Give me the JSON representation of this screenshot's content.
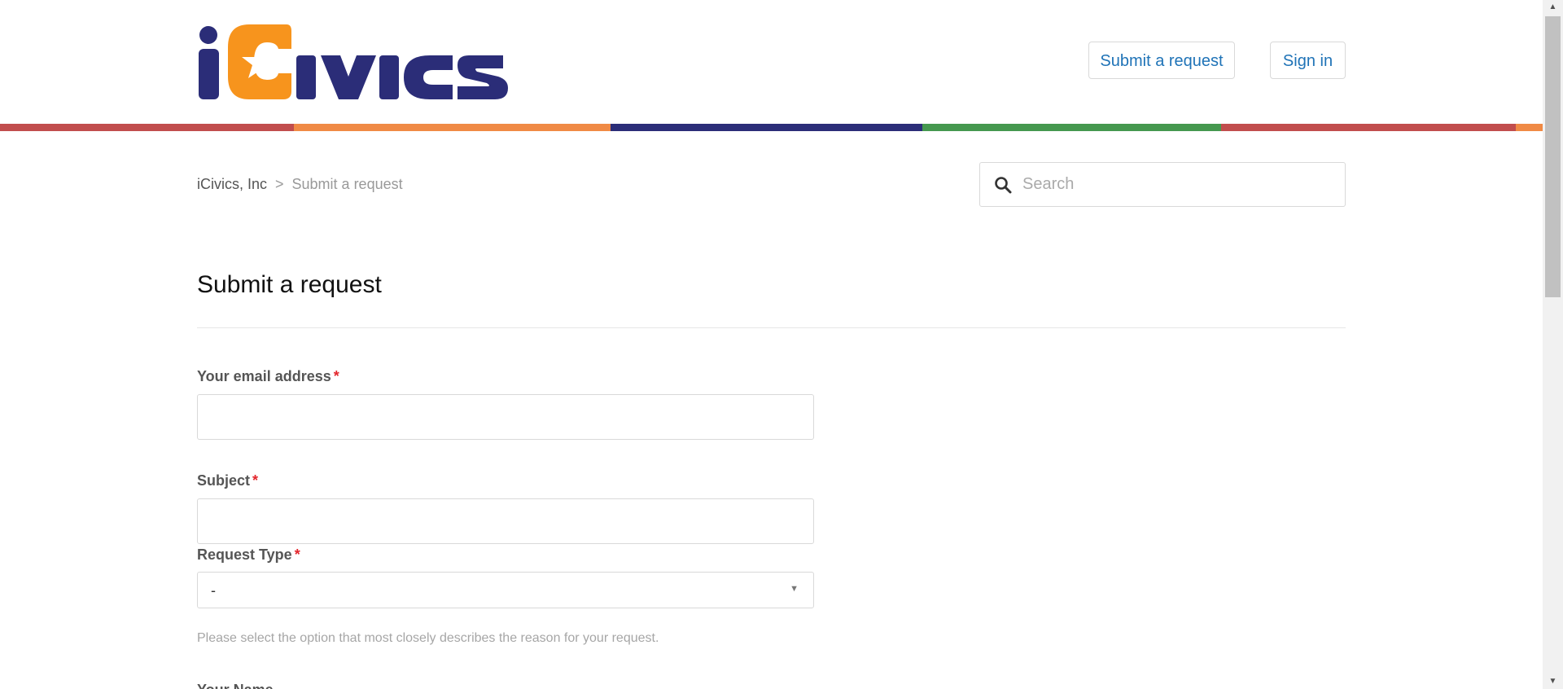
{
  "header": {
    "logo_text": "iCivics",
    "submit_request_label": "Submit a request",
    "sign_in_label": "Sign in"
  },
  "stripe_colors": [
    "#c14d4d",
    "#f08a45",
    "#2b2d78",
    "#45984f",
    "#c14d4d",
    "#f08a45"
  ],
  "breadcrumb": {
    "home": "iCivics, Inc",
    "separator": ">",
    "current": "Submit a request"
  },
  "search": {
    "placeholder": "Search",
    "icon": "search-icon"
  },
  "main": {
    "title": "Submit a request"
  },
  "form": {
    "email_label": "Your email address",
    "subject_label": "Subject",
    "request_type_label": "Request Type",
    "request_type_value": "-",
    "request_type_hint": "Please select the option that most closely describes the reason for your request.",
    "name_label": "Your Name",
    "required_marker": "*"
  },
  "colors": {
    "link": "#1f73b7",
    "required": "#e3262c",
    "logo_navy": "#2b2d78",
    "logo_orange": "#f7941d"
  }
}
